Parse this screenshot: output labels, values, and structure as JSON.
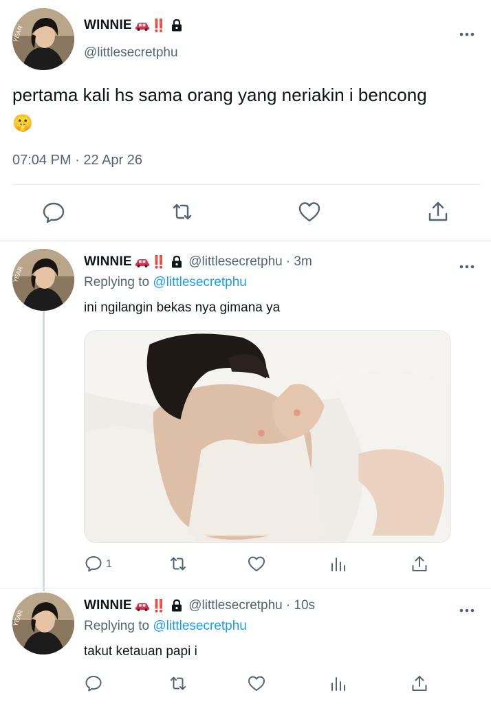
{
  "main_tweet": {
    "name": "WINNIE",
    "badge": "‼️",
    "handle": "@littlesecretphu",
    "text": "pertama kali hs sama orang yang neriakin i bencong",
    "emoji": "🤫",
    "timestamp": "07:04 PM · 22 Apr 26",
    "actions": [
      "reply-icon",
      "retweet-icon",
      "like-icon",
      "share-icon"
    ]
  },
  "replies": [
    {
      "name": "WINNIE",
      "badge": "‼️",
      "handle": "@littlesecretphu",
      "time": "· 3m",
      "replying_prefix": "Replying to",
      "replying_handle": "@littlesecretphu",
      "text": "ini ngilangin bekas nya gimana ya",
      "has_photo": true,
      "reply_count": "1"
    },
    {
      "name": "WINNIE",
      "badge": "‼️",
      "handle": "@littlesecretphu",
      "time": "· 10s",
      "replying_prefix": "Replying to",
      "replying_handle": "@littlesecretphu",
      "text": "takut ketauan papi i",
      "has_photo": false,
      "reply_count": ""
    }
  ],
  "colors": {
    "text": "#0f1419",
    "muted": "#536471",
    "link": "#1d9bf0",
    "badge": "#e0245e",
    "divider": "#e6ecf0"
  }
}
